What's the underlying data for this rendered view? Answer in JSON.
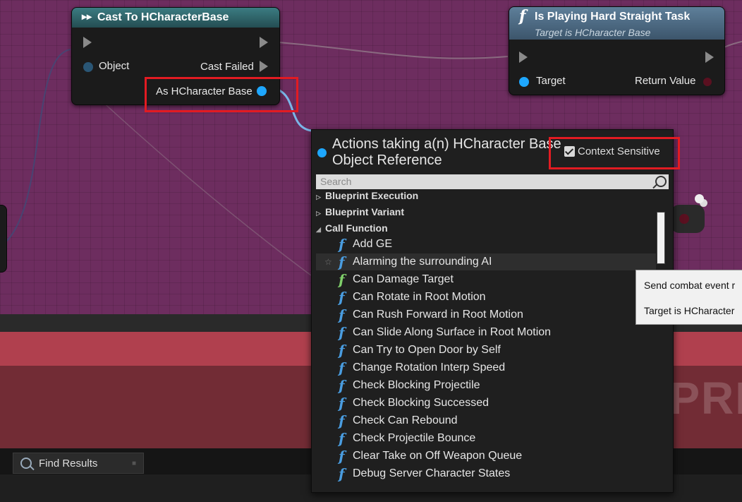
{
  "cast_node": {
    "title": "Cast To HCharacterBase",
    "pin_object": "Object",
    "pin_cast_failed": "Cast Failed",
    "pin_as": "As HCharacter Base"
  },
  "func_node": {
    "title": "Is Playing Hard Straight Task",
    "subtitle": "Target is HCharacter Base",
    "pin_target": "Target",
    "pin_return": "Return Value"
  },
  "menu": {
    "title": "Actions taking a(n) HCharacter Base Object Reference",
    "context_sensitive_label": "Context Sensitive",
    "context_sensitive_checked": true,
    "search_placeholder": "Search",
    "categories": [
      {
        "label": "Blueprint Execution",
        "expanded": false
      },
      {
        "label": "Blueprint Variant",
        "expanded": false
      },
      {
        "label": "Call Function",
        "expanded": true
      }
    ],
    "items": [
      {
        "label": "Add GE",
        "icon": "function-icon"
      },
      {
        "label": "Alarming the surrounding AI",
        "icon": "function-icon",
        "highlighted": true
      },
      {
        "label": "Can Damage Target",
        "icon": "pure-function-icon"
      },
      {
        "label": "Can Rotate in Root Motion",
        "icon": "function-icon"
      },
      {
        "label": "Can Rush Forward in Root Motion",
        "icon": "function-icon"
      },
      {
        "label": "Can Slide Along Surface in Root Motion",
        "icon": "function-icon"
      },
      {
        "label": "Can Try to Open Door by Self",
        "icon": "function-icon"
      },
      {
        "label": "Change Rotation Interp Speed",
        "icon": "function-icon"
      },
      {
        "label": "Check Blocking Projectile",
        "icon": "function-icon"
      },
      {
        "label": "Check Blocking Successed",
        "icon": "function-icon"
      },
      {
        "label": "Check Can Rebound",
        "icon": "function-icon"
      },
      {
        "label": "Check Projectile Bounce",
        "icon": "function-icon"
      },
      {
        "label": "Clear Take on Off Weapon Queue",
        "icon": "function-icon"
      },
      {
        "label": "Debug Server Character States",
        "icon": "function-icon"
      }
    ]
  },
  "tooltip": {
    "line1": "Send combat event r",
    "line2": "Target is HCharacter"
  },
  "bottom_tab": {
    "label": "Find Results"
  },
  "watermark": "PRI",
  "colors": {
    "graph_bg": "#6d2d5f",
    "object_pin": "#1ea7ff",
    "highlight_box": "#e21b22"
  }
}
